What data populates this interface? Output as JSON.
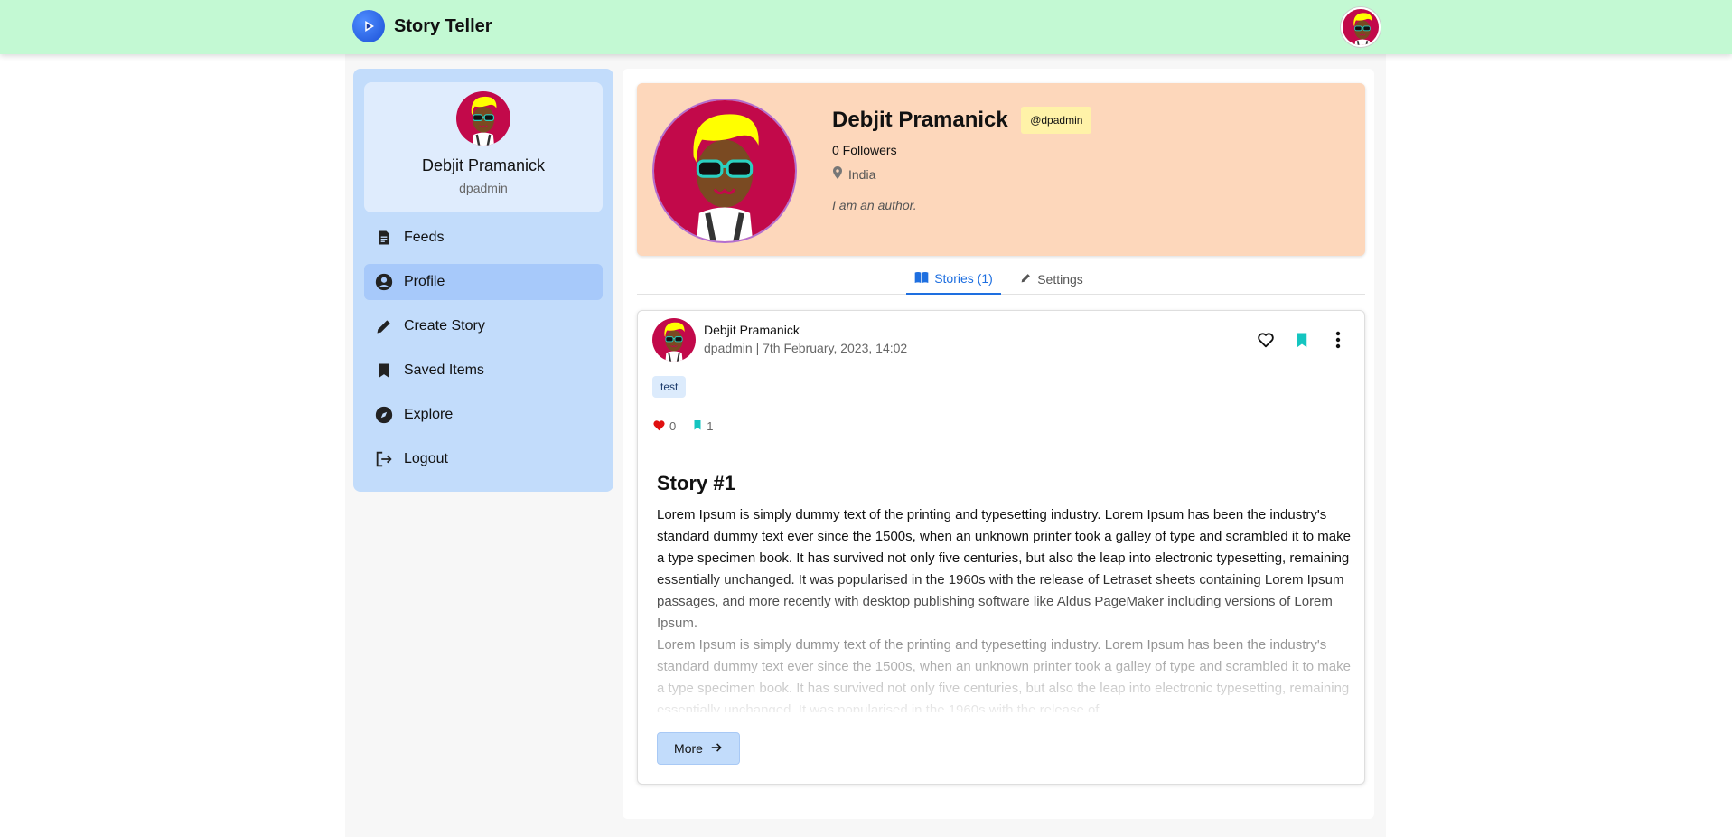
{
  "app": {
    "title": "Story Teller",
    "logo_icon": "play-icon",
    "accent": "#1e6fe0",
    "header_bg": "#c3f9d3"
  },
  "sidebar": {
    "user": {
      "name": "Debjit Pramanick",
      "handle": "dpadmin"
    },
    "items": [
      {
        "label": "Feeds",
        "icon": "article-icon",
        "active": false
      },
      {
        "label": "Profile",
        "icon": "account-circle-icon",
        "active": true
      },
      {
        "label": "Create Story",
        "icon": "pencil-icon",
        "active": false
      },
      {
        "label": "Saved Items",
        "icon": "bookmark-icon",
        "active": false
      },
      {
        "label": "Explore",
        "icon": "compass-icon",
        "active": false
      },
      {
        "label": "Logout",
        "icon": "logout-icon",
        "active": false
      }
    ]
  },
  "profile": {
    "name": "Debjit Pramanick",
    "handle": "@dpadmin",
    "followers": "0 Followers",
    "location": "India",
    "bio": "I am an author."
  },
  "tabs": [
    {
      "label": "Stories (1)",
      "icon": "book-icon",
      "active": true
    },
    {
      "label": "Settings",
      "icon": "pencil-icon",
      "active": false
    }
  ],
  "story": {
    "author": "Debjit Pramanick",
    "meta": "dpadmin | 7th February, 2023, 14:02",
    "tag": "test",
    "likes": "0",
    "saves": "1",
    "title": "Story #1",
    "paragraphs": [
      "Lorem Ipsum is simply dummy text of the printing and typesetting industry. Lorem Ipsum has been the industry's standard dummy text ever since the 1500s, when an unknown printer took a galley of type and scrambled it to make a type specimen book. It has survived not only five centuries, but also the leap into electronic typesetting, remaining essentially unchanged. It was popularised in the 1960s with the release of Letraset sheets containing Lorem Ipsum passages, and more recently with desktop publishing software like Aldus PageMaker including versions of Lorem Ipsum.",
      "Lorem Ipsum is simply dummy text of the printing and typesetting industry. Lorem Ipsum has been the industry's standard dummy text ever since the 1500s, when an unknown printer took a galley of type and scrambled it to make a type specimen book. It has survived not only five centuries, but also the leap into electronic typesetting, remaining essentially unchanged. It was popularised in the 1960s with the release of"
    ],
    "more_label": "More"
  }
}
